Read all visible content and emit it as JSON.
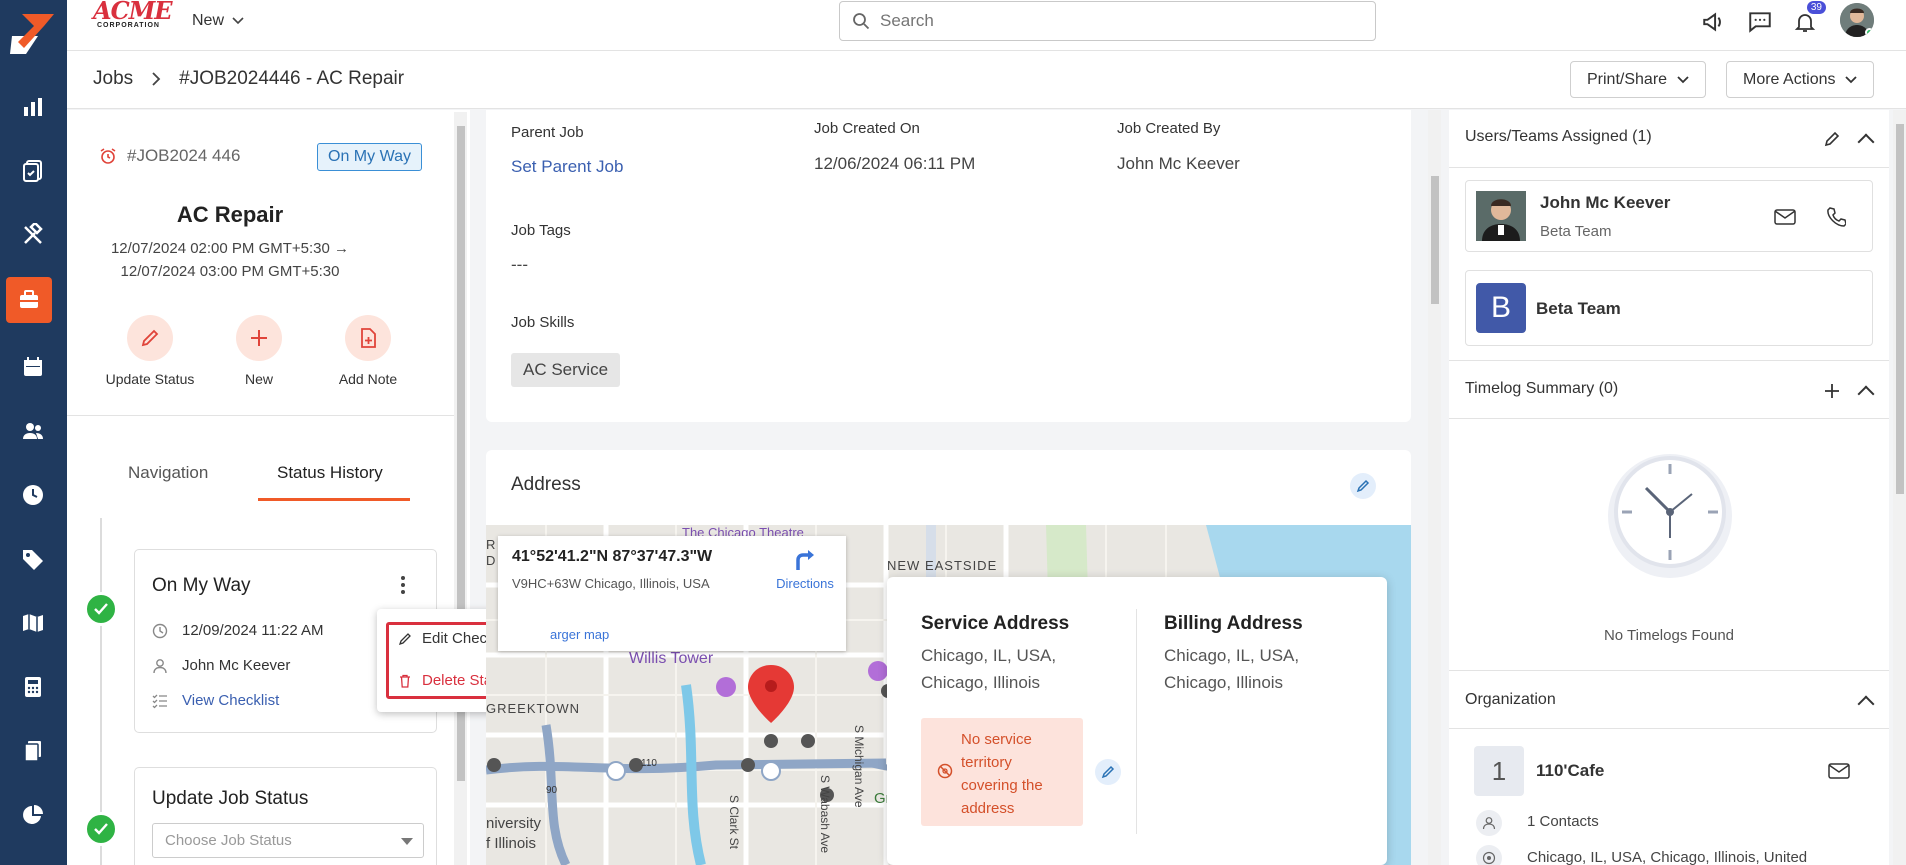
{
  "topbar": {
    "brand": "ACME",
    "brand_sub": "CORPORATION",
    "new_label": "New",
    "search_placeholder": "Search",
    "notification_count": "39"
  },
  "breadcrumb": {
    "root": "Jobs",
    "current": "#JOB2024446 - AC Repair"
  },
  "actions": {
    "print_share": "Print/Share",
    "more_actions": "More Actions"
  },
  "job": {
    "id": "#JOB2024 446",
    "status": "On My Way",
    "title": "AC Repair",
    "date_start": "12/07/2024 02:00 PM GMT+5:30 →",
    "date_end": "12/07/2024 03:00 PM GMT+5:30"
  },
  "quick_actions": {
    "update_status": "Update Status",
    "new": "New",
    "add_note": "Add Note"
  },
  "tabs": {
    "navigation": "Navigation",
    "status_history": "Status History"
  },
  "status_entry": {
    "title": "On My Way",
    "datetime": "12/09/2024 11:22 AM",
    "user": "John Mc Keever",
    "view_checklist": "View Checklist"
  },
  "context_menu": {
    "edit_checklist": "Edit Checklist",
    "delete_status": "Delete Status"
  },
  "update_job": {
    "title": "Update Job Status",
    "placeholder": "Choose Job Status"
  },
  "details": {
    "parent_job_label": "Parent Job",
    "parent_job_value": "Set Parent Job",
    "created_on_label": "Job Created On",
    "created_on_value": "12/06/2024 06:11 PM",
    "created_by_label": "Job Created By",
    "created_by_value": "John Mc Keever",
    "tags_label": "Job Tags",
    "tags_value": "---",
    "skills_label": "Job Skills",
    "skill_1": "AC Service"
  },
  "address": {
    "title": "Address",
    "coords": "41°52'41.2\"N 87°37'47.3\"W",
    "plus_code": "V9HC+63W Chicago, Illinois, USA",
    "directions": "Directions",
    "larger_map": "arger map",
    "service_title": "Service Address",
    "service_line1": "Chicago, IL, USA,",
    "service_line2": "Chicago, Illinois",
    "billing_title": "Billing Address",
    "billing_line1": "Chicago, IL, USA,",
    "billing_line2": "Chicago, Illinois",
    "warning": "No service territory covering the address",
    "map_labels": {
      "chicago_theatre": "The Chicago Theatre",
      "new_eastside": "NEW EASTSIDE",
      "willis_tower": "Willis Tower",
      "greektown": "GREEKTOWN",
      "clark_st": "S Clark St",
      "wabash": "S Wabash Ave",
      "michigan": "S Michigan Ave",
      "university": "niversity",
      "illinois": "f Illinois",
      "r": "R",
      "d": "D",
      "gr": "Gr",
      "route_90": "90",
      "route_110": "110"
    }
  },
  "right": {
    "assigned_title": "Users/Teams Assigned (1)",
    "user_name": "John Mc Keever",
    "user_team": "Beta Team",
    "team_initial": "B",
    "team_name": "Beta Team",
    "timelog_title": "Timelog Summary (0)",
    "no_timelogs": "No Timelogs Found",
    "org_title": "Organization",
    "org_initial": "1",
    "org_name": "110'Cafe",
    "contacts": "1 Contacts",
    "org_address": "Chicago, IL, USA, Chicago, Illinois, United"
  },
  "colors": {
    "rail": "#1f3a5f",
    "accent": "#f05a28",
    "link": "#3a5fb0",
    "success": "#2fb344",
    "danger": "#d9303e"
  }
}
